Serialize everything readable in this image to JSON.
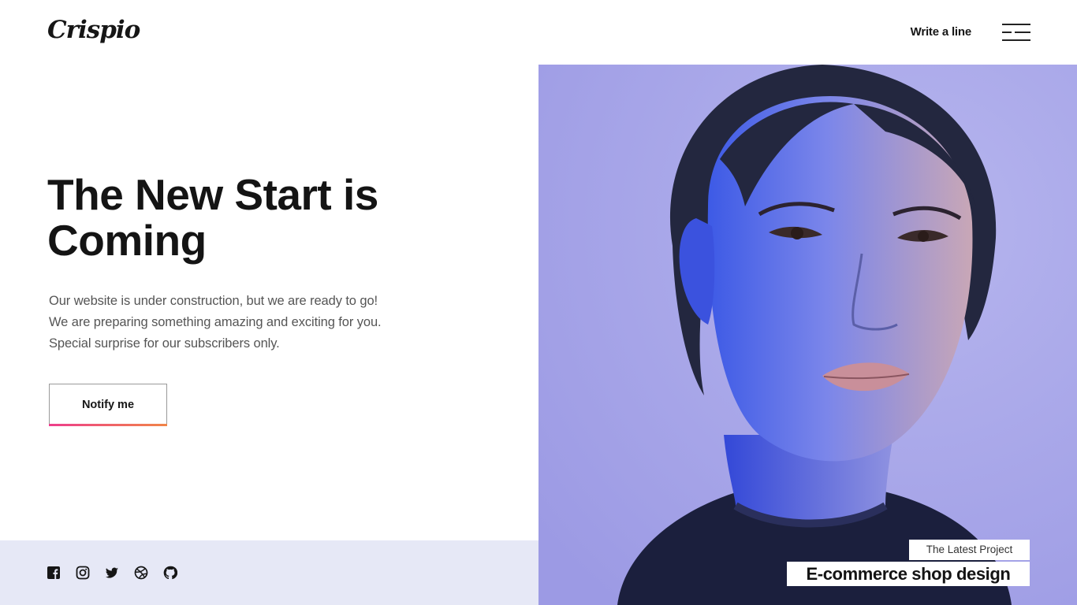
{
  "brand": {
    "logo_text": "Crispio"
  },
  "nav": {
    "write_label": "Write a line",
    "menu_icon": "hamburger-menu-icon"
  },
  "hero": {
    "title": "The New Start is Coming",
    "lines": [
      "Our website is under construction, but we are ready to go!",
      "We are preparing something amazing and exciting for you.",
      "Special surprise for our subscribers only."
    ],
    "notify_label": "Notify me"
  },
  "socials": [
    "facebook-icon",
    "instagram-icon",
    "twitter-icon",
    "dribbble-icon",
    "github-icon"
  ],
  "project": {
    "label": "The Latest Project",
    "title": "E-commerce shop design"
  },
  "colors": {
    "accent_gradient_start": "#ee3d8c",
    "accent_gradient_end": "#f08548",
    "footer_band": "#e6e8f6",
    "photo_background": "#a8a6ea"
  }
}
